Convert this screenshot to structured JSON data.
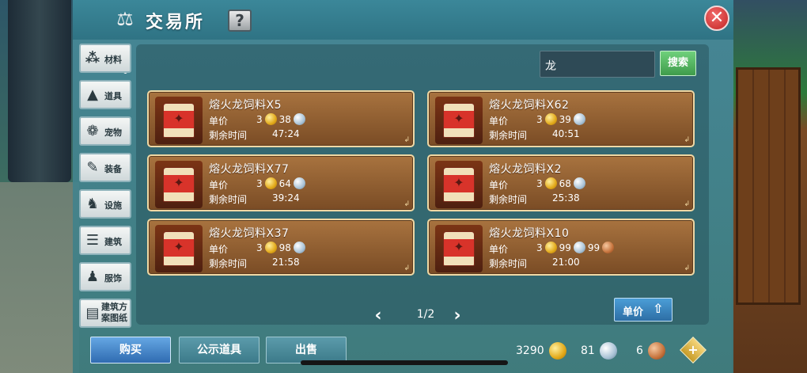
{
  "header": {
    "title": "交易所",
    "help_label": "?",
    "close_label": "✕"
  },
  "sidebar": {
    "items": [
      {
        "label": "材料",
        "icon": "ore-icon"
      },
      {
        "label": "道具",
        "icon": "tool-icon"
      },
      {
        "label": "宠物",
        "icon": "paw-icon"
      },
      {
        "label": "装备",
        "icon": "equipment-icon"
      },
      {
        "label": "设施",
        "icon": "facility-icon"
      },
      {
        "label": "建筑",
        "icon": "building-icon"
      },
      {
        "label": "服饰",
        "icon": "clothing-icon"
      },
      {
        "label": "建筑方案图纸",
        "icon": "blueprint-icon"
      }
    ]
  },
  "search": {
    "value": "龙",
    "button_label": "搜索"
  },
  "labels": {
    "unit_price": "单价",
    "remaining_time": "剩余时间"
  },
  "listings": [
    {
      "name": "熔火龙饲料X5",
      "gold": "3",
      "silver": "38",
      "copper": "",
      "time": "47:24"
    },
    {
      "name": "熔火龙饲料X62",
      "gold": "3",
      "silver": "39",
      "copper": "",
      "time": "40:51"
    },
    {
      "name": "熔火龙饲料X77",
      "gold": "3",
      "silver": "64",
      "copper": "",
      "time": "39:24"
    },
    {
      "name": "熔火龙饲料X2",
      "gold": "3",
      "silver": "68",
      "copper": "",
      "time": "25:38"
    },
    {
      "name": "熔火龙饲料X37",
      "gold": "3",
      "silver": "98",
      "copper": "",
      "time": "21:58"
    },
    {
      "name": "熔火龙饲料X10",
      "gold": "3",
      "silver": "99",
      "copper": "99",
      "time": "21:00"
    }
  ],
  "pager": {
    "text": "1/2",
    "prev": "‹",
    "next": "›"
  },
  "sort": {
    "label": "单价"
  },
  "bottom": {
    "buy": "购买",
    "public_items": "公示道具",
    "sell": "出售",
    "gold_amount": "3290",
    "silver_amount": "81",
    "copper_amount": "6",
    "add_label": "+"
  },
  "colors": {
    "window": "#3b8799",
    "card": "#8a5a2f",
    "search_button": "#4fb35c",
    "buy_button": "#3c7fc4",
    "close_button": "#d63a3a"
  }
}
